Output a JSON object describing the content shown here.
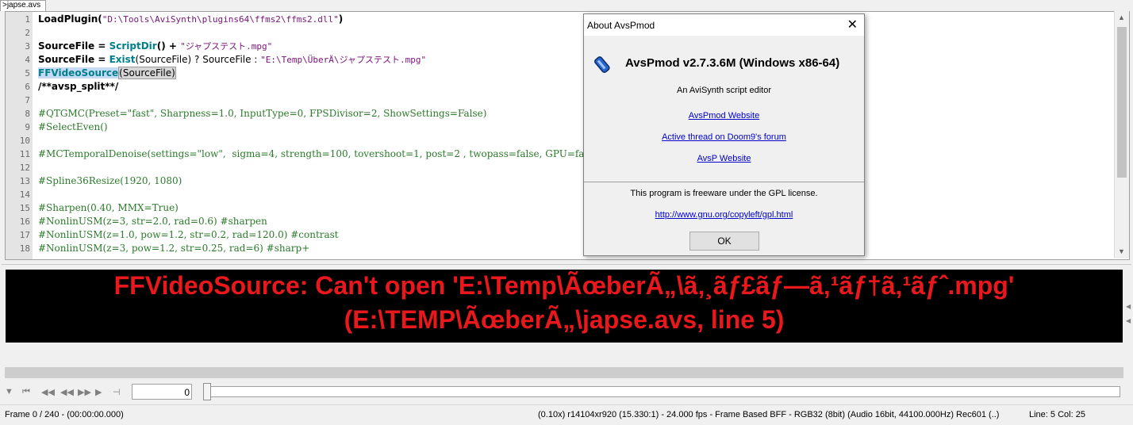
{
  "tab": {
    "label": ">japse.avs"
  },
  "editor": {
    "line_numbers": [
      "1",
      "2",
      "3",
      "4",
      "5",
      "6",
      "7",
      "8",
      "9",
      "10",
      "11",
      "12",
      "13",
      "14",
      "15",
      "16",
      "17",
      "18"
    ],
    "lines": {
      "l1": {
        "fn": "LoadPlugin",
        "open": "(",
        "str": "\"D:\\Tools\\AviSynth\\plugins64\\ffms2\\ffms2.dll\"",
        "close": ")"
      },
      "l3": {
        "var": "SourceFile",
        "eq": " = ",
        "fn": "ScriptDir",
        "rest": "() + ",
        "str": "\"ジャプステスト.mpg\""
      },
      "l4": {
        "var": "SourceFile",
        "eq": " = ",
        "fn": "Exist",
        "arg": "(SourceFile)",
        "mid": " ? SourceFile : ",
        "str": "\"E:\\Temp\\ÜberÄ\\ジャプステスト.mpg\""
      },
      "l5": {
        "fn": "FFVideoSource",
        "arg": "(SourceFile)"
      },
      "l6": "/**avsp_split**/",
      "l8": "#QTGMC(Preset=\"fast\", Sharpness=1.0, InputType=0, FPSDivisor=2, ShowSettings=False)",
      "l9": "#SelectEven()",
      "l11": "#MCTemporalDenoise(settings=\"low\",  sigma=4, strength=100, tovershoot=1, post=2 , twopass=false, GPU=false)",
      "l13": "#Spline36Resize(1920, 1080)",
      "l15": "#Sharpen(0.40, MMX=True)",
      "l16": "#NonlinUSM(z=3, str=2.0, rad=0.6) #sharpen",
      "l17": "#NonlinUSM(z=1.0, pow=1.2, str=0.2, rad=120.0) #contrast",
      "l18": "#NonlinUSM(z=3, pow=1.2, str=0.25, rad=6) #sharp+"
    }
  },
  "preview": {
    "error_line1": "FFVideoSource: Can't open 'E:\\Temp\\ÃœberÃ„\\ã‚¸ãƒ£ãƒ—ã‚¹ãƒ†ã‚¹ãƒˆ.mpg'",
    "error_line2": "(E:\\TEMP\\ÃœberÃ„\\japse.avs, line 5)"
  },
  "transport": {
    "frame_value": "0"
  },
  "status": {
    "left": "Frame 0 / 240  -  (00:00:00.000)",
    "middle": "(0.10x)  r14104xr920 (15.330:1) - 24.000 fps - Frame Based BFF - RGB32 (8bit) (Audio 16bit, 44100.000Hz) Rec601 (..)",
    "position": "Line: 5  Col: 25"
  },
  "dialog": {
    "title": "About AvsPmod",
    "close": "✕",
    "heading": "AvsPmod v2.7.3.6M (Windows x86-64)",
    "subtitle": "An AviSynth script editor",
    "link1": "AvsPmod Website",
    "link2": "Active thread on Doom9's forum",
    "link3": "AvsP Website",
    "license": "This program is freeware under the GPL license.",
    "gpl_link": "http://www.gnu.org/copyleft/gpl.html",
    "ok": "OK"
  },
  "colors": {
    "error_red": "#e8181c",
    "comment_green": "#2b7a2b",
    "function_teal": "#00808a",
    "string_purple": "#7a127a",
    "link_blue": "#0000cc"
  }
}
